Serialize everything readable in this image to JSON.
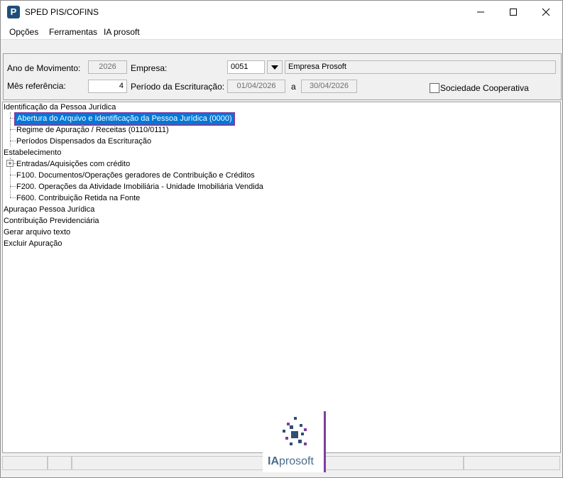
{
  "window": {
    "title": "SPED PIS/COFINS",
    "app_icon_letter": "P"
  },
  "menu": {
    "items": [
      {
        "label": "Opções"
      },
      {
        "label": "Ferramentas"
      },
      {
        "label": "IA prosoft"
      }
    ]
  },
  "form": {
    "ano_label": "Ano de Movimento:",
    "ano_value": "2026",
    "empresa_label": "Empresa:",
    "empresa_code": "0051",
    "empresa_name": "Empresa Prosoft",
    "mes_label": "Mês referência:",
    "mes_value": "4",
    "periodo_label": "Período da Escrituração:",
    "periodo_inicio": "01/04/2026",
    "periodo_sep": "a",
    "periodo_fim": "30/04/2026",
    "sociedade_label": "Sociedade Cooperativa",
    "sociedade_checked": false
  },
  "tree": {
    "nodes": [
      {
        "label": "Identificação da Pessoa Jurídica",
        "level": 0
      },
      {
        "label": "Abertura do Arquivo e Identificação da Pessoa Jurídica (0000)",
        "level": 1,
        "selected": true
      },
      {
        "label": "Regime de Apuração / Receitas (0110/0111)",
        "level": 1
      },
      {
        "label": "Períodos Dispensados da Escrituração",
        "level": 1
      },
      {
        "label": "Estabelecimento",
        "level": 0
      },
      {
        "label": "Entradas/Aquisições com crédito",
        "level": 1,
        "expandable": true
      },
      {
        "label": "F100. Documentos/Operações geradores de Contribuição e Créditos",
        "level": 1
      },
      {
        "label": "F200. Operações da Atividade Imobiliária - Unidade Imobiliária Vendida",
        "level": 1
      },
      {
        "label": "F600. Contribuição Retida na Fonte",
        "level": 1
      },
      {
        "label": "Apuraçao Pessoa Jurídica",
        "level": 0
      },
      {
        "label": "Contribuição Previdenciária",
        "level": 0
      },
      {
        "label": "Gerar arquivo texto",
        "level": 0
      },
      {
        "label": "Excluir Apuração",
        "level": 0
      }
    ]
  },
  "logo": {
    "text_ia": "IA",
    "text_prosoft": "prosoft",
    "accent_color": "#7b3fa0",
    "brand_color": "#2f4f73"
  },
  "colors": {
    "selection": "#0078d7",
    "selection_border": "#7b3fa0"
  }
}
